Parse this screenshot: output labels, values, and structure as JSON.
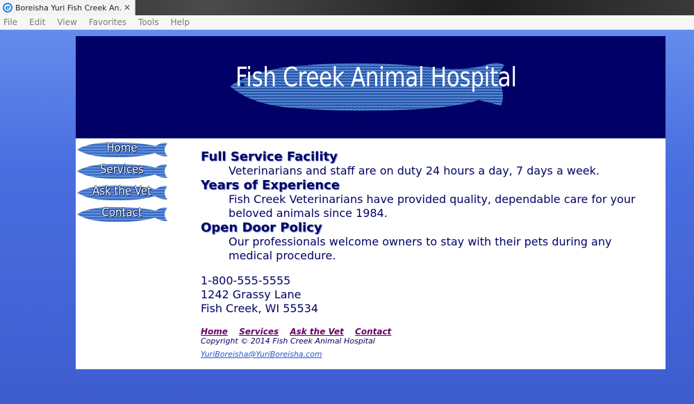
{
  "browser": {
    "tab_title": "Boreisha Yuri Fish Creek An...",
    "tab_close": "✕",
    "menu": [
      "File",
      "Edit",
      "View",
      "Favorites",
      "Tools",
      "Help"
    ]
  },
  "banner": {
    "title": "Fish Creek Animal Hospital"
  },
  "nav": [
    {
      "label": "Home"
    },
    {
      "label": "Services"
    },
    {
      "label": "Ask the Vet"
    },
    {
      "label": "Contact"
    }
  ],
  "sections": [
    {
      "heading": "Full Service Facility",
      "text": "Veterinarians and staff are on duty 24 hours a day, 7 days a week."
    },
    {
      "heading": "Years of Experience",
      "text": "Fish Creek Veterinarians have provided quality, dependable care for your beloved animals since 1984."
    },
    {
      "heading": "Open Door Policy",
      "text": "Our professionals welcome owners to stay with their pets during any medical procedure."
    }
  ],
  "contact": {
    "phone": "1-800-555-5555",
    "street": "1242 Grassy Lane",
    "city": "Fish Creek, WI 55534"
  },
  "footer": {
    "links": [
      "Home",
      "Services",
      "Ask the Vet",
      "Contact"
    ],
    "copyright": "Copyright © 2014 Fish Creek Animal Hospital",
    "email": "YuriBoreisha@YuriBoreisha.com"
  },
  "colors": {
    "banner_bg": "#000066",
    "text": "#000066",
    "footer_link": "#660066",
    "background": "#4a6fe0"
  }
}
